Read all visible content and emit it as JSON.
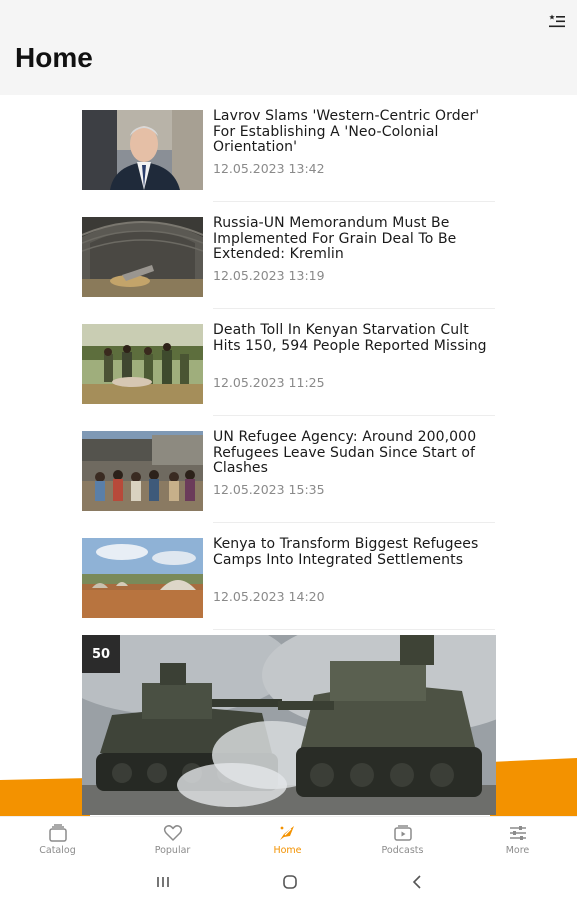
{
  "header": {
    "title": "Home",
    "menu_icon": "list-star-icon"
  },
  "articles": [
    {
      "headline": "Lavrov Slams 'Western-Centric Order' For Establishing A 'Neo-Colonial Orientation'",
      "date": "12.05.2023 13:42"
    },
    {
      "headline": "Russia-UN Memorandum Must Be Implemented For Grain Deal To Be Extended: Kremlin",
      "date": "12.05.2023 13:19"
    },
    {
      "headline": "Death Toll In Kenyan Starvation Cult Hits 150, 594 People Reported Missing",
      "date": "12.05.2023 11:25"
    },
    {
      "headline": "UN Refugee Agency: Around 200,000 Refugees Leave Sudan Since Start of Clashes",
      "date": "12.05.2023 15:35"
    },
    {
      "headline": "Kenya to Transform Biggest Refugees Camps Into Integrated Settlements",
      "date": "12.05.2023 14:20"
    }
  ],
  "hero": {
    "badge": "50"
  },
  "tabs": [
    {
      "label": "Catalog",
      "icon": "catalog-icon"
    },
    {
      "label": "Popular",
      "icon": "heart-icon"
    },
    {
      "label": "Home",
      "icon": "home-rocket-icon",
      "active": true
    },
    {
      "label": "Podcasts",
      "icon": "podcast-icon"
    },
    {
      "label": "More",
      "icon": "sliders-icon"
    }
  ],
  "colors": {
    "accent": "#f39200",
    "header_bg": "#f5f5f5",
    "text": "#1a1a1a",
    "muted": "#8a8a8a"
  }
}
